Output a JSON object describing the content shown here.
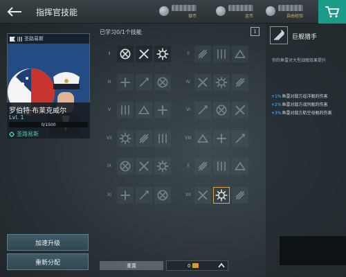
{
  "header": {
    "title": "指挥官技能",
    "back_icon": "back-arrow-icon",
    "currencies": [
      {
        "label": "银币",
        "icon": "silver-coin-icon"
      },
      {
        "label": "金币",
        "icon": "gold-coin-icon"
      },
      {
        "label": "自由经验",
        "icon": "free-xp-icon"
      }
    ],
    "shop_icon": "shopping-cart-icon"
  },
  "captain": {
    "nation_label": "圣路易斯",
    "name": "罗伯特·布莱克威尔",
    "level": "Lvl. 1",
    "xp_text": "0/1500",
    "xp_progress": 0,
    "ship": "圣路易斯"
  },
  "buttons": {
    "accelerate": "加速升级",
    "redistribute": "重新分配",
    "reset": "重置"
  },
  "skill_grid": {
    "learned_label": "已学习0/1个技能",
    "info_label": "i",
    "tiers": [
      "I",
      "II",
      "III",
      "IV",
      "V",
      "VI",
      "VII",
      "VIII",
      "IX",
      "X",
      "XI",
      "XII"
    ]
  },
  "points": {
    "value": "0"
  },
  "selected_skill": {
    "title": "巨舰猎手",
    "description": "你的鱼雷对大型战舰效果提升",
    "effects": [
      {
        "pct": "+1%",
        "text": "鱼雷对敌方巡洋舰的伤害"
      },
      {
        "pct": "+2%",
        "text": "鱼雷对敌方战列舰的伤害"
      },
      {
        "pct": "+3%",
        "text": "鱼雷对敌方航空母舰的伤害"
      }
    ]
  },
  "colors": {
    "accent": "#1b9c8a",
    "selection": "#d9a640",
    "effect_value": "#5cb8ff"
  }
}
